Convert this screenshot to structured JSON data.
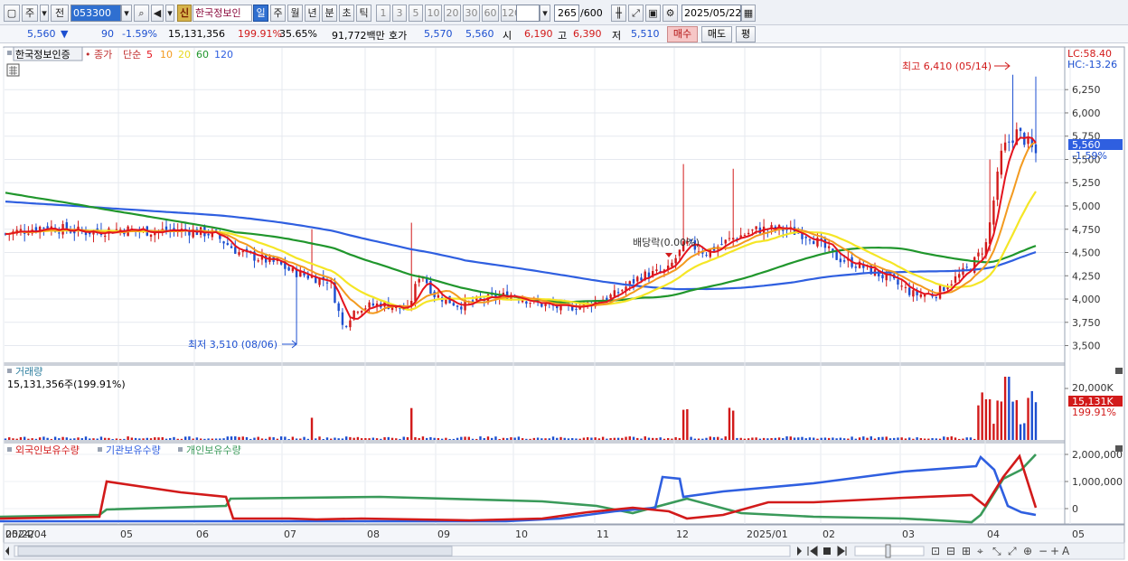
{
  "toolbar": {
    "mode_label": "주",
    "prev_label": "전",
    "code_value": "053300",
    "sin_tag": "신",
    "stock_name": "한국정보인",
    "periods": [
      "일",
      "주",
      "월",
      "년",
      "분",
      "초",
      "틱"
    ],
    "active_period": "일",
    "intervals": [
      "1",
      "3",
      "5",
      "10",
      "20",
      "30",
      "60",
      "120"
    ],
    "count": "265",
    "count_total": "/600",
    "date": "2025/05/22"
  },
  "quote": {
    "price": "5,560",
    "arrow": "▼",
    "change": "90",
    "change_rate": "-1.59%",
    "volume": "15,131,356",
    "volume_rate": "199.91%",
    "turnover": "35.65%",
    "amount": "91,772백만",
    "ask_label": "호가",
    "ask": "5,570",
    "bid": "5,560",
    "open_label": "시",
    "open": "6,190",
    "high_label": "고",
    "high": "6,390",
    "low_label": "저",
    "low": "5,510",
    "buy_button": "매수",
    "sell_button": "매도",
    "eval_button": "평"
  },
  "colors": {
    "ma5": "#e4141e",
    "ma10": "#f39a1f",
    "ma20": "#f5e626",
    "ma60": "#20962c",
    "ma120": "#2f5fe0",
    "up": "#d21a1a",
    "down": "#1c4fd0",
    "foreign": "#d21a1a",
    "institution": "#2f5fe0",
    "individual": "#3a9a5a"
  },
  "chart_data": [
    {
      "type": "candlestick",
      "legend": {
        "name": "한국정보인증",
        "close_label": "종가",
        "ma_label": "단순",
        "ma_periods": [
          "5",
          "10",
          "20",
          "60",
          "120"
        ]
      },
      "y_ticks": [
        "6,250",
        "6,000",
        "5,750",
        "5,500",
        "5,250",
        "5,000",
        "4,750",
        "4,500",
        "4,250",
        "4,000",
        "3,750",
        "3,500"
      ],
      "ylim": [
        3350,
        6650
      ],
      "x_ticks": [
        "2024/04",
        "05",
        "06",
        "07",
        "08",
        "09",
        "10",
        "11",
        "12",
        "2025/01",
        "02",
        "03",
        "04",
        "05",
        "05/22"
      ],
      "indicators": {
        "lc": "LC:58.40",
        "hc": "HC:-13.26"
      },
      "current": {
        "price": "5,560",
        "change": "-1.59%"
      },
      "annotations": {
        "high": "최고 6,410 (05/14)",
        "low": "최저 3,510 (08/06)",
        "dividend": "배당락(0.00%)"
      }
    },
    {
      "type": "bar",
      "title": "거래량",
      "value_label": "15,131,356주(199.91%)",
      "y_ticks": [
        "20,000K"
      ],
      "current": {
        "value": "15,131K",
        "rate": "199.91%"
      }
    },
    {
      "type": "line",
      "series_names": [
        "외국인보유수량",
        "기관보유수량",
        "개인보유수량"
      ],
      "y_ticks": [
        "2,000,000",
        "1,000,000",
        "0"
      ]
    }
  ]
}
